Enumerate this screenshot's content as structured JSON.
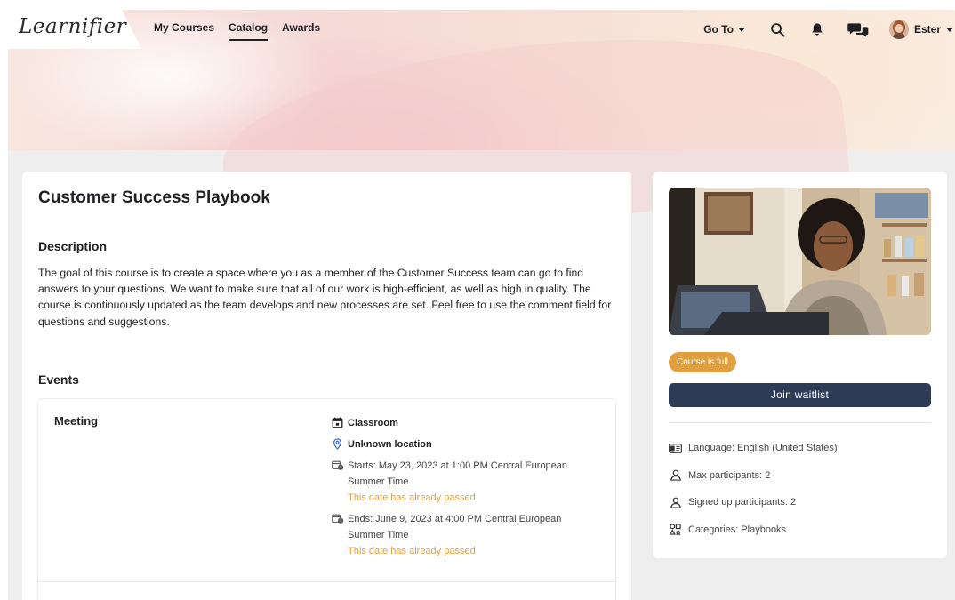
{
  "header": {
    "logo": "Learnifier",
    "nav": [
      {
        "label": "My Courses",
        "active": false
      },
      {
        "label": "Catalog",
        "active": true
      },
      {
        "label": "Awards",
        "active": false
      }
    ],
    "goto_label": "Go To",
    "user_name": "Ester",
    "icons": [
      "search-icon",
      "bell-icon",
      "chat-icon",
      "avatar"
    ]
  },
  "course": {
    "title": "Customer Success Playbook",
    "description_heading": "Description",
    "description": "The goal of this course is to create a space where you as a member of the Customer Success team can go to find answers to your questions. We want to make sure that all of our work is high-efficient, as well as high in quality. The course is continuously updated as the team develops and new processes are set. Feel free to use the comment field for questions and suggestions.",
    "events_heading": "Events",
    "events": [
      {
        "name": "Meeting",
        "type": "Classroom",
        "location": "Unknown location",
        "starts": "Starts: May 23, 2023 at 1:00 PM Central European Summer Time",
        "starts_note": "This date has already passed",
        "ends": "Ends: June 9, 2023 at 4:00 PM Central European Summer Time",
        "ends_note": "This date has already passed"
      }
    ]
  },
  "sidebar": {
    "status_badge": "Course is full",
    "join_button": "Join waitlist",
    "language": "Language: English (United States)",
    "max_participants": "Max participants: 2",
    "signed_up": "Signed up participants: 2",
    "categories": "Categories: Playbooks"
  },
  "colors": {
    "accent_orange": "#e0a040",
    "button_navy": "#2d3b57",
    "text_dark": "#1f2024"
  }
}
